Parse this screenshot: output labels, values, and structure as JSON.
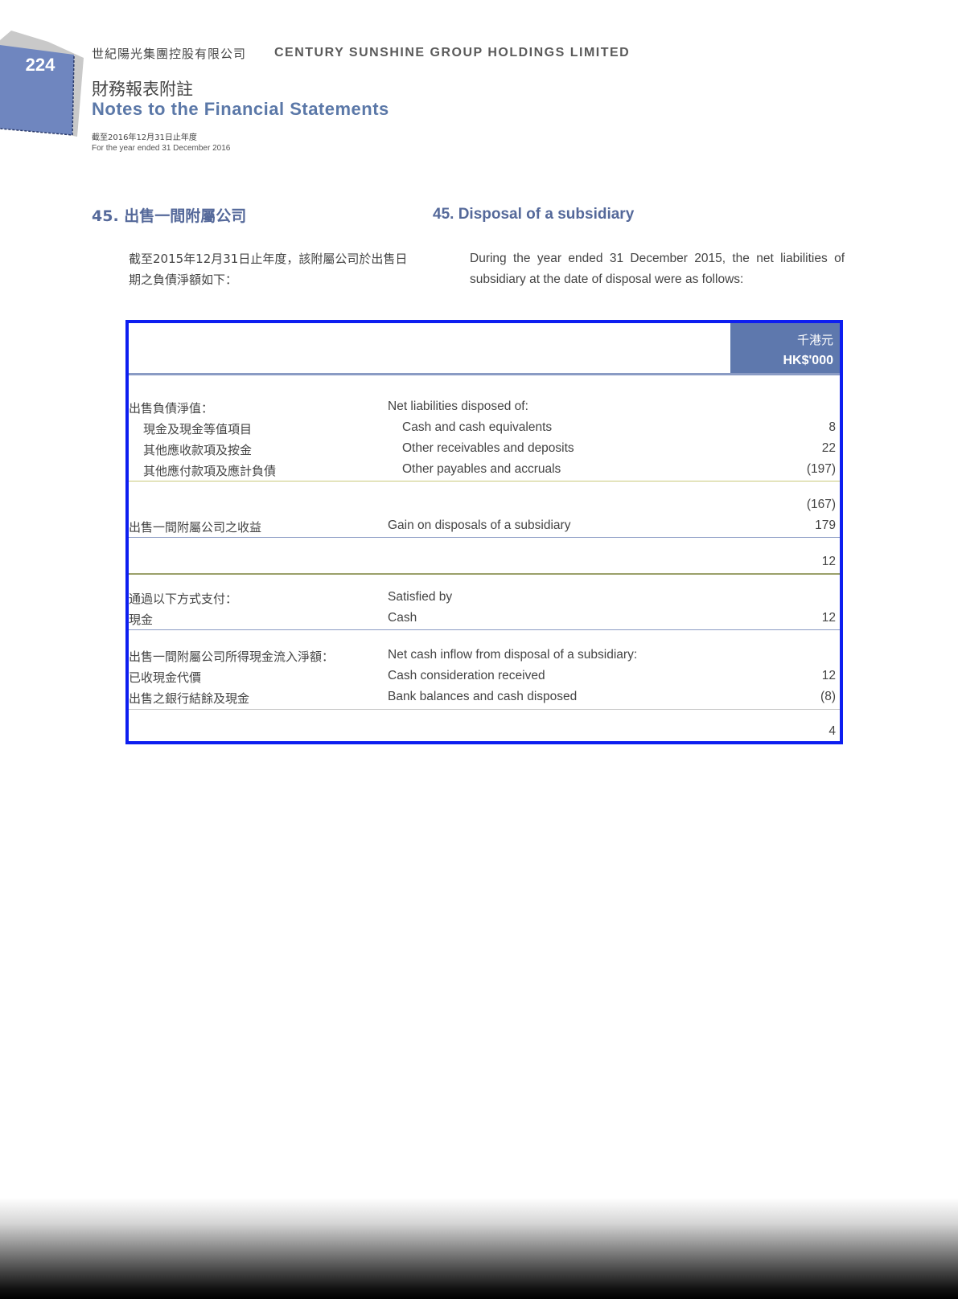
{
  "header": {
    "page_number": "224",
    "company_cn": "世紀陽光集團控股有限公司",
    "company_en": "CENTURY SUNSHINE GROUP HOLDINGS LIMITED",
    "notes_cn": "財務報表附註",
    "notes_en": "Notes to the Financial Statements",
    "period_cn": "截至2016年12月31日止年度",
    "period_en": "For the year ended 31 December 2016"
  },
  "section": {
    "title_cn": "45. 出售一間附屬公司",
    "title_en": "45. Disposal of a subsidiary",
    "intro_cn": "截至2015年12月31日止年度，該附屬公司於出售日期之負債淨額如下：",
    "intro_en": "During the year ended 31 December 2015, the net liabilities of subsidiary at the date of disposal were as follows:"
  },
  "table": {
    "currency_cn": "千港元",
    "currency_en": "HK$'000",
    "rows": [
      {
        "cn": "出售負債淨值：",
        "en": "Net liabilities disposed of:",
        "value": ""
      },
      {
        "cn": "現金及現金等值項目",
        "en": "Cash and cash equivalents",
        "value": "8"
      },
      {
        "cn": "其他應收款項及按金",
        "en": "Other receivables and deposits",
        "value": "22"
      },
      {
        "cn": "其他應付款項及應計負債",
        "en": "Other payables and accruals",
        "value": "(197)"
      },
      {
        "cn": "",
        "en": "",
        "value": "(167)"
      },
      {
        "cn": "出售一間附屬公司之收益",
        "en": "Gain on disposals of a subsidiary",
        "value": "179"
      },
      {
        "cn": "",
        "en": "",
        "value": "12"
      },
      {
        "cn": "通過以下方式支付：",
        "en": "Satisfied by",
        "value": ""
      },
      {
        "cn": "現金",
        "en": "Cash",
        "value": "12"
      },
      {
        "cn": "出售一間附屬公司所得現金流入淨額：",
        "en": "Net cash inflow from disposal of a subsidiary:",
        "value": ""
      },
      {
        "cn": "已收現金代價",
        "en": "Cash consideration received",
        "value": "12"
      },
      {
        "cn": "出售之銀行結餘及現金",
        "en": "Bank balances and cash disposed",
        "value": "(8)"
      },
      {
        "cn": "",
        "en": "",
        "value": "4"
      }
    ]
  }
}
